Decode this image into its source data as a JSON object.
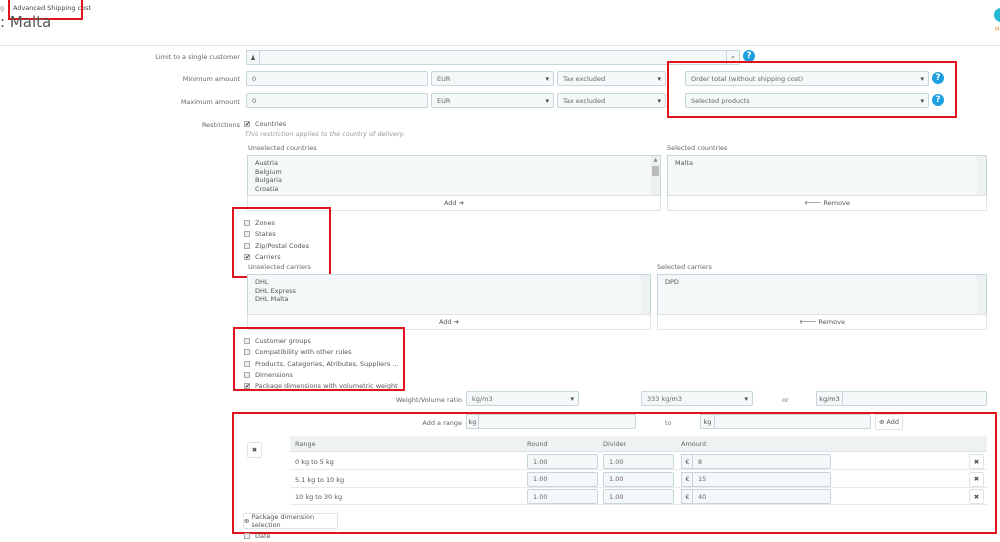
{
  "breadcrumb": {
    "prev": "g",
    "current": "Advanced Shipping cost"
  },
  "title": ": Malta",
  "header_right": {
    "letter": "H"
  },
  "fields": {
    "limit_customer": {
      "label": "Limit to a single customer",
      "value": ""
    },
    "minimum": {
      "label": "Minimum amount",
      "value": "0",
      "currency": "EUR",
      "tax": "Tax excluded",
      "basis": "Order total (without shipping cost)"
    },
    "maximum": {
      "label": "Maximum amount",
      "value": "0",
      "currency": "EUR",
      "tax": "Tax excluded",
      "basis": "Selected products"
    }
  },
  "restrictions": {
    "label": "Restrictions",
    "countries": {
      "label": "Countries",
      "checked": true,
      "hint": "This restriction applies to the country of delivery.",
      "unselected_label": "Unselected countries",
      "unselected": [
        "Austria",
        "Belgium",
        "Bulgaria",
        "Croatia"
      ],
      "selected_label": "Selected countries",
      "selected": [
        "Malta"
      ],
      "add": "Add ➔",
      "remove": "🡐 Remove"
    },
    "zones": {
      "label": "Zones",
      "checked": false
    },
    "states": {
      "label": "States",
      "checked": false
    },
    "zip": {
      "label": "Zip/Postal Codes",
      "checked": false
    },
    "carriers": {
      "label": "Carriers",
      "checked": true,
      "unselected_label": "Unselected carriers",
      "unselected": [
        "DHL",
        "DHL Express",
        "DHL Malta"
      ],
      "selected_label": "Selected carriers",
      "selected": [
        "DPD"
      ],
      "add": "Add ➔",
      "remove": "🡐 Remove"
    },
    "customer_groups": {
      "label": "Customer groups",
      "checked": false
    },
    "compatibility": {
      "label": "Compatibility with other rules",
      "checked": false
    },
    "products": {
      "label": "Products, Categories, Atributes, Suppliers ...",
      "checked": false
    },
    "dimensions": {
      "label": "Dimensions",
      "checked": false
    },
    "package": {
      "label": "Package dimensions with volumetric weight",
      "checked": true
    },
    "date": {
      "label": "Date",
      "checked": false
    }
  },
  "ratio": {
    "label": "Weight/Volume ratio",
    "unit_select": "kg/m3",
    "value_select": "333 kg/m3",
    "or": "or",
    "custom_unit": "kg/m3",
    "custom_value": ""
  },
  "range": {
    "label": "Add a range",
    "unit": "kg",
    "to": "to",
    "add": "Add",
    "from_value": "",
    "to_value": ""
  },
  "table": {
    "headers": [
      "Range",
      "Round",
      "Divider",
      "Amount"
    ],
    "currency": "€",
    "rows": [
      {
        "range": "0 kg to 5 kg",
        "round": "1.00",
        "divider": "1.00",
        "amount": "8"
      },
      {
        "range": "5.1 kg to 10 kg",
        "round": "1.00",
        "divider": "1.00",
        "amount": "15"
      },
      {
        "range": "10 kg to 30 kg",
        "round": "1.00",
        "divider": "1.00",
        "amount": "40"
      }
    ]
  },
  "package_button": "Package dimension selection",
  "colors": {
    "highlight": "#e0141e",
    "help": "#1e9fe0"
  }
}
